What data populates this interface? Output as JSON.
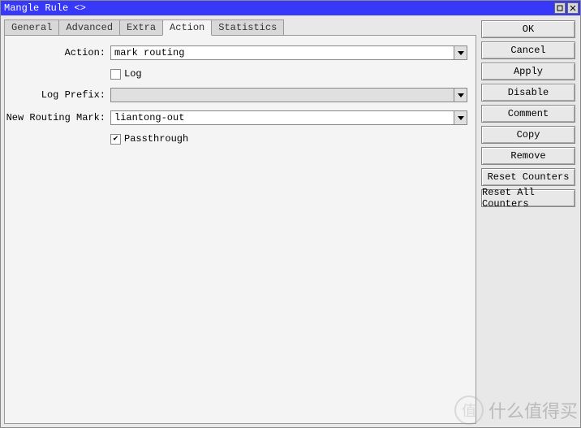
{
  "window": {
    "title": "Mangle Rule <>"
  },
  "tabs": {
    "general": "General",
    "advanced": "Advanced",
    "extra": "Extra",
    "action": "Action",
    "statistics": "Statistics"
  },
  "form": {
    "action_label": "Action:",
    "action_value": "mark routing",
    "log_label": "Log",
    "log_checked": false,
    "log_prefix_label": "Log Prefix:",
    "log_prefix_value": "",
    "new_routing_mark_label": "New Routing Mark:",
    "new_routing_mark_value": "liantong-out",
    "passthrough_label": "Passthrough",
    "passthrough_checked": true
  },
  "buttons": {
    "ok": "OK",
    "cancel": "Cancel",
    "apply": "Apply",
    "disable": "Disable",
    "comment": "Comment",
    "copy": "Copy",
    "remove": "Remove",
    "reset_counters": "Reset Counters",
    "reset_all_counters": "Reset All Counters"
  },
  "watermark": {
    "icon": "值",
    "text": "什么值得买"
  }
}
